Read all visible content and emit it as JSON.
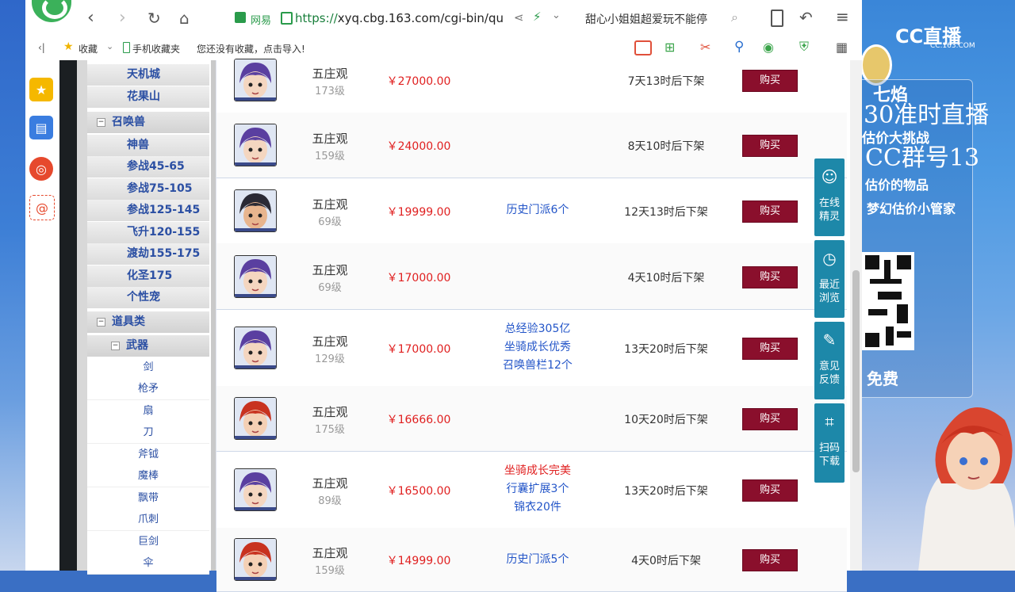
{
  "browser": {
    "url_prefix": "https://",
    "url_domain": "xyq.cbg.163.com",
    "url_path": "/cgi-bin/qu",
    "site_label": "网易",
    "search_text": "甜心小姐姐超爱玩不能停"
  },
  "bookmarks": {
    "sidebar_toggle": "‹|",
    "favorites": "收藏",
    "mobile_favorites": "手机收藏夹",
    "import_prompt": "您还没有收藏，点击导入!"
  },
  "tree": {
    "items": [
      {
        "label": "天机城",
        "kind": "leaf"
      },
      {
        "label": "花果山",
        "kind": "leaf"
      },
      {
        "label": "召唤兽",
        "kind": "group"
      },
      {
        "label": "神兽",
        "kind": "leaf"
      },
      {
        "label": "参战45-65",
        "kind": "leaf"
      },
      {
        "label": "参战75-105",
        "kind": "leaf"
      },
      {
        "label": "参战125-145",
        "kind": "leaf"
      },
      {
        "label": "飞升120-155",
        "kind": "leaf"
      },
      {
        "label": "渡劫155-175",
        "kind": "leaf"
      },
      {
        "label": "化圣175",
        "kind": "leaf"
      },
      {
        "label": "个性宠",
        "kind": "leaf"
      },
      {
        "label": "道具类",
        "kind": "group"
      },
      {
        "label": "武器",
        "kind": "subgroup"
      },
      {
        "label": "剑",
        "kind": "sub"
      },
      {
        "label": "枪矛",
        "kind": "sub"
      },
      {
        "label": "扇",
        "kind": "sub"
      },
      {
        "label": "刀",
        "kind": "sub"
      },
      {
        "label": "斧钺",
        "kind": "sub"
      },
      {
        "label": "魔棒",
        "kind": "sub"
      },
      {
        "label": "飘带",
        "kind": "sub"
      },
      {
        "label": "爪刺",
        "kind": "sub"
      },
      {
        "label": "巨剑",
        "kind": "sub"
      },
      {
        "label": "伞",
        "kind": "sub"
      }
    ]
  },
  "listings": [
    {
      "school": "五庄观",
      "level": "173级",
      "price": "￥27000.00",
      "desc": [],
      "desc_color": "blue",
      "time": "7天13时后下架",
      "buy": "购买",
      "avatar": "purple"
    },
    {
      "school": "五庄观",
      "level": "159级",
      "price": "￥24000.00",
      "desc": [],
      "desc_color": "blue",
      "time": "8天10时后下架",
      "buy": "购买",
      "avatar": "purple"
    },
    {
      "school": "五庄观",
      "level": "69级",
      "price": "￥19999.00",
      "desc": [
        "历史门派6个"
      ],
      "desc_color": "blue",
      "time": "12天13时后下架",
      "buy": "购买",
      "avatar": "dark"
    },
    {
      "school": "五庄观",
      "level": "69级",
      "price": "￥17000.00",
      "desc": [],
      "desc_color": "blue",
      "time": "4天10时后下架",
      "buy": "购买",
      "avatar": "purple"
    },
    {
      "school": "五庄观",
      "level": "129级",
      "price": "￥17000.00",
      "desc": [
        "总经验305亿",
        "坐骑成长优秀",
        "召唤兽栏12个"
      ],
      "desc_color": "blue",
      "time": "13天20时后下架",
      "buy": "购买",
      "avatar": "purple"
    },
    {
      "school": "五庄观",
      "level": "175级",
      "price": "￥16666.00",
      "desc": [],
      "desc_color": "blue",
      "time": "10天20时后下架",
      "buy": "购买",
      "avatar": "red"
    },
    {
      "school": "五庄观",
      "level": "89级",
      "price": "￥16500.00",
      "desc": [
        "坐骑成长完美",
        "行囊扩展3个",
        "锦衣20件"
      ],
      "desc_color": "mixed",
      "time": "13天20时后下架",
      "buy": "购买",
      "avatar": "purple"
    },
    {
      "school": "五庄观",
      "level": "159级",
      "price": "￥14999.00",
      "desc": [
        "历史门派5个"
      ],
      "desc_color": "blue",
      "time": "4天0时后下架",
      "buy": "购买",
      "avatar": "red"
    }
  ],
  "side_panel": [
    {
      "label": "在线精灵",
      "icon": "sprite-icon"
    },
    {
      "label": "最近浏览",
      "icon": "clock-icon"
    },
    {
      "label": "意见反馈",
      "icon": "edit-icon"
    },
    {
      "label": "扫码下载",
      "icon": "scan-icon"
    }
  ],
  "stream_overlay": {
    "brand": "CC直播",
    "brand_sub": "CC.163.COM",
    "name": "七焰",
    "line1": "30准时直播",
    "line2": "估价大挑战",
    "line3": "CC群号13",
    "line4": "估价的物品",
    "line5": "梦幻估价小管家",
    "line6": "免费"
  },
  "colors": {
    "buy_button": "#8a0f2c",
    "price": "#e02020",
    "link_blue": "#2355c8",
    "side_panel": "#1d88a9"
  }
}
